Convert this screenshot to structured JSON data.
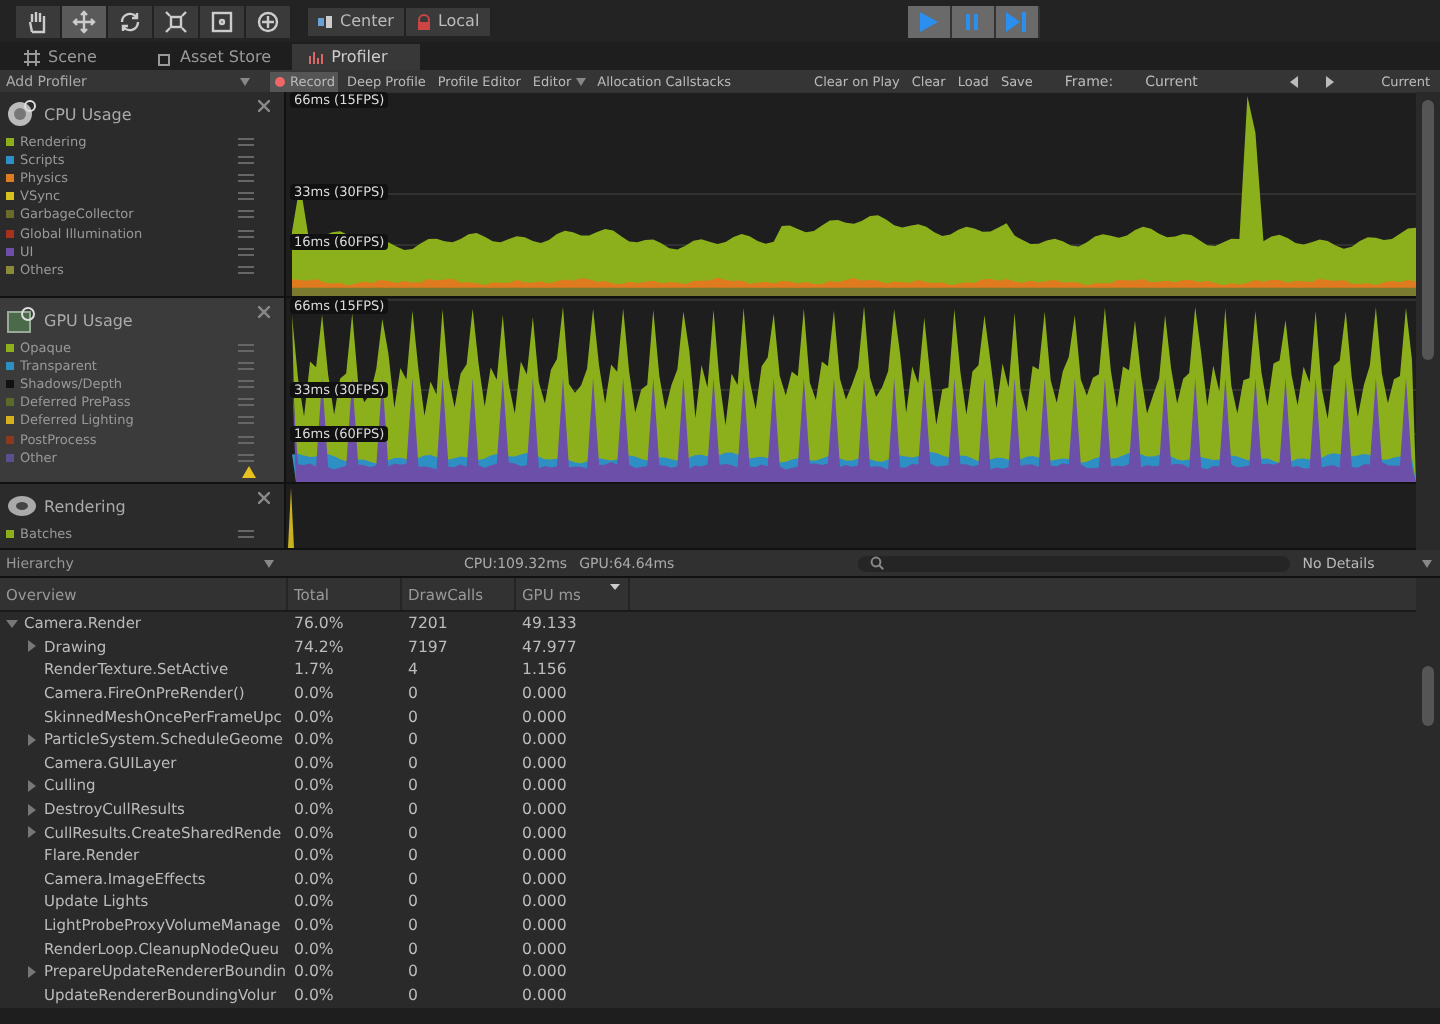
{
  "toolbar": {
    "tools": [
      {
        "kind": "hand",
        "selected": false
      },
      {
        "kind": "move",
        "selected": true
      },
      {
        "kind": "rotate",
        "selected": false
      },
      {
        "kind": "scale",
        "selected": false
      },
      {
        "kind": "rect",
        "selected": false
      },
      {
        "kind": "transform",
        "selected": false
      }
    ],
    "pivot": [
      {
        "kind": "pivot",
        "label": "Center"
      },
      {
        "kind": "local",
        "label": "Local"
      }
    ],
    "playback": [
      {
        "kind": "play"
      },
      {
        "kind": "pause"
      },
      {
        "kind": "step"
      }
    ]
  },
  "tabs": [
    {
      "kind": "scene",
      "label": "Scene",
      "selected": false
    },
    {
      "kind": "store",
      "label": "Asset Store",
      "selected": false
    },
    {
      "kind": "profiler",
      "label": "Profiler",
      "selected": true
    }
  ],
  "profiler_toolbar": {
    "add_profiler": "Add Profiler",
    "left_buttons": [
      {
        "label": "Record",
        "on": true,
        "kind": "record"
      },
      {
        "label": "Deep Profile",
        "on": false
      },
      {
        "label": "Profile Editor",
        "on": false
      },
      {
        "label": "Editor",
        "on": false,
        "kind": "dropdown"
      },
      {
        "label": "Allocation Callstacks",
        "on": false
      }
    ],
    "right_buttons": [
      {
        "label": "Clear on Play",
        "on": false
      },
      {
        "label": "Clear",
        "on": false
      },
      {
        "label": "Load",
        "on": false
      },
      {
        "label": "Save",
        "on": false
      }
    ],
    "frame_label": "Frame:",
    "frame_value": "Current",
    "current_button": "Current"
  },
  "areas": [
    {
      "kind": "cpu",
      "title": "CPU Usage",
      "selected": false,
      "warning": false,
      "fps_labels": [
        "66ms (15FPS)",
        "33ms (30FPS)",
        "16ms (60FPS)"
      ],
      "legend": [
        {
          "label": "Rendering",
          "color": "#8fae1b"
        },
        {
          "label": "Scripts",
          "color": "#2e8fc4"
        },
        {
          "label": "Physics",
          "color": "#e07a1f"
        },
        {
          "label": "VSync",
          "color": "#d6c11f"
        },
        {
          "label": "GarbageCollector",
          "color": "#6a6a2a"
        },
        {
          "label": "Global Illumination",
          "color": "#a8321e"
        },
        {
          "label": "UI",
          "color": "#6b4fa8"
        },
        {
          "label": "Others",
          "color": "#8a8a3a"
        }
      ]
    },
    {
      "kind": "gpu",
      "title": "GPU Usage",
      "selected": true,
      "warning": true,
      "fps_labels": [
        "66ms (15FPS)",
        "33ms (30FPS)",
        "16ms (60FPS)"
      ],
      "legend": [
        {
          "label": "Opaque",
          "color": "#8fae1b"
        },
        {
          "label": "Transparent",
          "color": "#2e8fc4"
        },
        {
          "label": "Shadows/Depth",
          "color": "#111111"
        },
        {
          "label": "Deferred PrePass",
          "color": "#5a6a2a"
        },
        {
          "label": "Deferred Lighting",
          "color": "#d6b11f"
        },
        {
          "label": "PostProcess",
          "color": "#8a3a1e"
        },
        {
          "label": "Other",
          "color": "#5a4f8a"
        }
      ]
    },
    {
      "kind": "rendering",
      "title": "Rendering",
      "selected": false,
      "warning": false,
      "legend": [
        {
          "label": "Batches",
          "color": "#8fae1b"
        }
      ]
    }
  ],
  "hierarchy_bar": {
    "view": "Hierarchy",
    "cpu": "CPU:109.32ms",
    "gpu": "GPU:64.64ms",
    "details": "No Details"
  },
  "table": {
    "columns": [
      {
        "label": "Overview",
        "sorted": false
      },
      {
        "label": "Total",
        "sorted": false
      },
      {
        "label": "DrawCalls",
        "sorted": false
      },
      {
        "label": "GPU ms",
        "sorted": true
      }
    ],
    "rows": [
      {
        "name": "Camera.Render",
        "total": "76.0%",
        "drawcalls": "7201",
        "gpu": "49.133",
        "expanded": true,
        "children": [
          {
            "name": "Drawing",
            "total": "74.2%",
            "drawcalls": "7197",
            "gpu": "47.977",
            "expanded": false
          },
          {
            "name": "RenderTexture.SetActive",
            "total": "1.7%",
            "drawcalls": "4",
            "gpu": "1.156"
          },
          {
            "name": "Camera.FireOnPreRender()",
            "total": "0.0%",
            "drawcalls": "0",
            "gpu": "0.000"
          },
          {
            "name": "SkinnedMeshOncePerFrameUpc",
            "total": "0.0%",
            "drawcalls": "0",
            "gpu": "0.000"
          },
          {
            "name": "ParticleSystem.ScheduleGeome",
            "total": "0.0%",
            "drawcalls": "0",
            "gpu": "0.000",
            "expanded": false
          },
          {
            "name": "Camera.GUILayer",
            "total": "0.0%",
            "drawcalls": "0",
            "gpu": "0.000"
          },
          {
            "name": "Culling",
            "total": "0.0%",
            "drawcalls": "0",
            "gpu": "0.000",
            "expanded": false
          },
          {
            "name": "DestroyCullResults",
            "total": "0.0%",
            "drawcalls": "0",
            "gpu": "0.000",
            "expanded": false
          },
          {
            "name": "CullResults.CreateSharedRende",
            "total": "0.0%",
            "drawcalls": "0",
            "gpu": "0.000",
            "expanded": false
          },
          {
            "name": "Flare.Render",
            "total": "0.0%",
            "drawcalls": "0",
            "gpu": "0.000"
          },
          {
            "name": "Camera.ImageEffects",
            "total": "0.0%",
            "drawcalls": "0",
            "gpu": "0.000"
          },
          {
            "name": "Update Lights",
            "total": "0.0%",
            "drawcalls": "0",
            "gpu": "0.000"
          },
          {
            "name": "LightProbeProxyVolumeManage",
            "total": "0.0%",
            "drawcalls": "0",
            "gpu": "0.000"
          },
          {
            "name": "RenderLoop.CleanupNodeQueu",
            "total": "0.0%",
            "drawcalls": "0",
            "gpu": "0.000"
          },
          {
            "name": "PrepareUpdateRendererBoundin",
            "total": "0.0%",
            "drawcalls": "0",
            "gpu": "0.000",
            "expanded": false
          },
          {
            "name": "UpdateRendererBoundingVolur",
            "total": "0.0%",
            "drawcalls": "0",
            "gpu": "0.000"
          }
        ]
      }
    ]
  }
}
